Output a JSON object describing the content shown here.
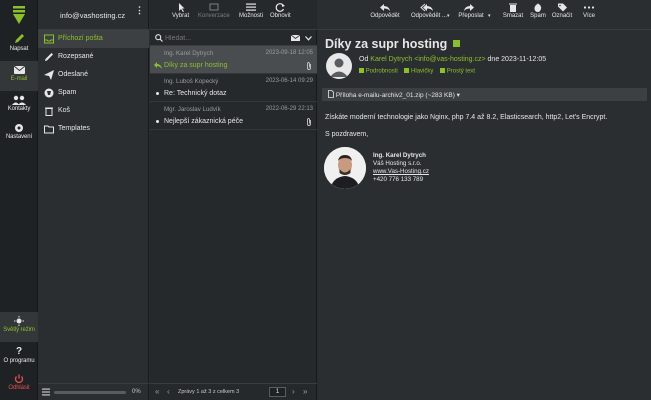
{
  "rail": {
    "compose": "Napsat",
    "email": "E-mail",
    "contacts": "Kontakty",
    "settings": "Nastavení",
    "light_mode": "Světlý režim",
    "about": "O programu",
    "logout": "Odhlásit"
  },
  "account": {
    "email": "info@vashosting.cz"
  },
  "folders": [
    {
      "label": "Příchozí pošta"
    },
    {
      "label": "Rozepsané"
    },
    {
      "label": "Odeslané"
    },
    {
      "label": "Spam"
    },
    {
      "label": "Koš"
    },
    {
      "label": "Templates"
    }
  ],
  "quota": {
    "percent": "0%",
    "value": 0
  },
  "list_toolbar": {
    "select": "Vybrat",
    "threads": "Konverzace",
    "options": "Možnosti",
    "refresh": "Obnovit"
  },
  "search": {
    "placeholder": "Hledat..."
  },
  "messages": [
    {
      "from": "Ing. Karel Dytrych",
      "date": "2023-09-18 12:05",
      "subject": "Díky za supr hosting"
    },
    {
      "from": "Ing. Luboš Kopecký",
      "date": "2023-06-14 09:29",
      "subject": "Re: Technický dotaz"
    },
    {
      "from": "Mgr. Jaroslav Ludvík",
      "date": "2022-06-29 22:13",
      "subject": "Nejlepší zákaznická péče"
    }
  ],
  "pagination": {
    "text": "Zprávy 1 až 3 z celkem 3",
    "page": "1"
  },
  "read_toolbar": {
    "reply": "Odpovědět",
    "reply_all": "Odpovědět ...",
    "forward": "Přeposlat",
    "delete": "Smazat",
    "spam": "Spam",
    "mark": "Označit",
    "more": "Více"
  },
  "email": {
    "subject": "Díky za supr hosting",
    "from_prefix": "Od",
    "from_name": "Karel Dytrych",
    "from_addr": "<info@vas-hosting.cz>",
    "date_text": "dne 2023-11-12:05",
    "details": "Podrobnosti",
    "headers": "Hlavičky",
    "plain": "Prostý text",
    "attachment": "Příloha e-mailu-archiv2_01.zip (~283 KB)",
    "body_line": "Získáte moderní technologie jako Nginx, php 7.4 až 8.2, Elasticsearch, http2, Let's Encrypt.",
    "greeting": "S pozdravem,",
    "sig_name": "Ing. Karel Dytrych",
    "sig_company": "Váš Hosting s.r.o.",
    "sig_web": "www.Vas-Hosting.cz",
    "sig_phone": "+420 776 133 789"
  },
  "colors": {
    "accent": "#8bbf2c",
    "danger": "#e05050",
    "bg": "#2b2e31",
    "rail": "#1f2224"
  }
}
